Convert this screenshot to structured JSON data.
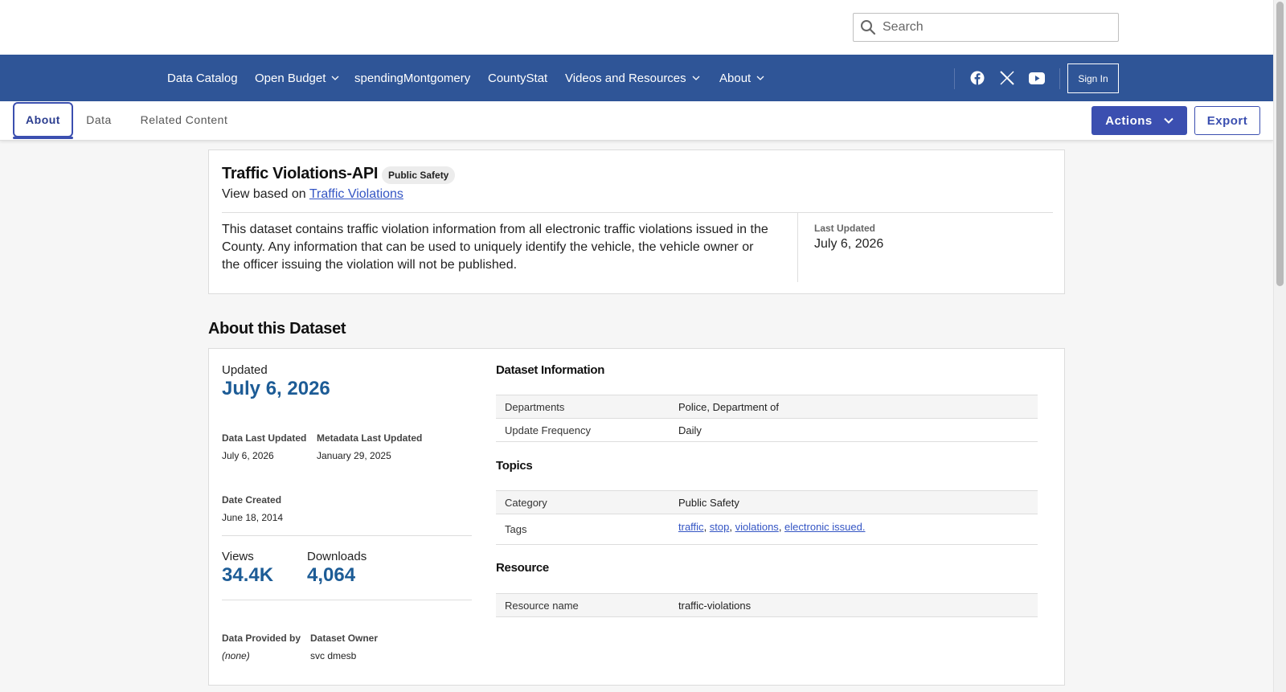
{
  "search": {
    "placeholder": "Search"
  },
  "nav": {
    "items": [
      {
        "label": "Data Catalog",
        "dropdown": false
      },
      {
        "label": "Open Budget",
        "dropdown": true
      },
      {
        "label": "spendingMontgomery",
        "dropdown": false
      },
      {
        "label": "CountyStat",
        "dropdown": false
      },
      {
        "label": "Videos and Resources",
        "dropdown": true
      },
      {
        "label": "About",
        "dropdown": true
      }
    ],
    "social": [
      "facebook-icon",
      "x-twitter-icon",
      "youtube-icon"
    ],
    "signin_label": "Sign In"
  },
  "tabs": [
    {
      "label": "About",
      "active": true
    },
    {
      "label": "Data",
      "active": false
    },
    {
      "label": "Related Content",
      "active": false
    }
  ],
  "toolbar": {
    "actions_label": "Actions",
    "export_label": "Export"
  },
  "summary": {
    "title": "Traffic Violations-API",
    "badge": "Public Safety",
    "based_prefix": "View based on",
    "based_link": "Traffic Violations",
    "description": "This dataset contains traffic violation information from all electronic traffic violations issued in the County. Any information that can be used to uniquely identify the vehicle, the vehicle owner or the officer issuing the violation will not be published.",
    "last_updated_label": "Last Updated",
    "last_updated_value": "July 6, 2026"
  },
  "about": {
    "heading": "About this Dataset",
    "updated_label": "Updated",
    "updated_value": "July 6, 2026",
    "data_last_updated_label": "Data Last Updated",
    "data_last_updated_value": "July 6, 2026",
    "metadata_last_updated_label": "Metadata Last Updated",
    "metadata_last_updated_value": "January 29, 2025",
    "date_created_label": "Date Created",
    "date_created_value": "June 18, 2014",
    "views_label": "Views",
    "views_value": "34.4K",
    "downloads_label": "Downloads",
    "downloads_value": "4,064",
    "provided_by_label": "Data Provided by",
    "provided_by_value": "(none)",
    "owner_label": "Dataset Owner",
    "owner_value": "svc dmesb"
  },
  "dataset_info": {
    "heading": "Dataset Information",
    "departments_label": "Departments",
    "departments_value": "Police, Department of",
    "frequency_label": "Update Frequency",
    "frequency_value": "Daily"
  },
  "topics": {
    "heading": "Topics",
    "category_label": "Category",
    "category_value": "Public Safety",
    "tags_label": "Tags",
    "tags": [
      "traffic",
      "stop",
      "violations",
      "electronic issued."
    ]
  },
  "resource": {
    "heading": "Resource",
    "name_label": "Resource name",
    "name_value": "traffic-violations"
  },
  "colors": {
    "nav_blue": "#2f5597",
    "accent": "#3b4fb0",
    "stat_blue": "#1d5c96",
    "link": "#3455c4"
  }
}
